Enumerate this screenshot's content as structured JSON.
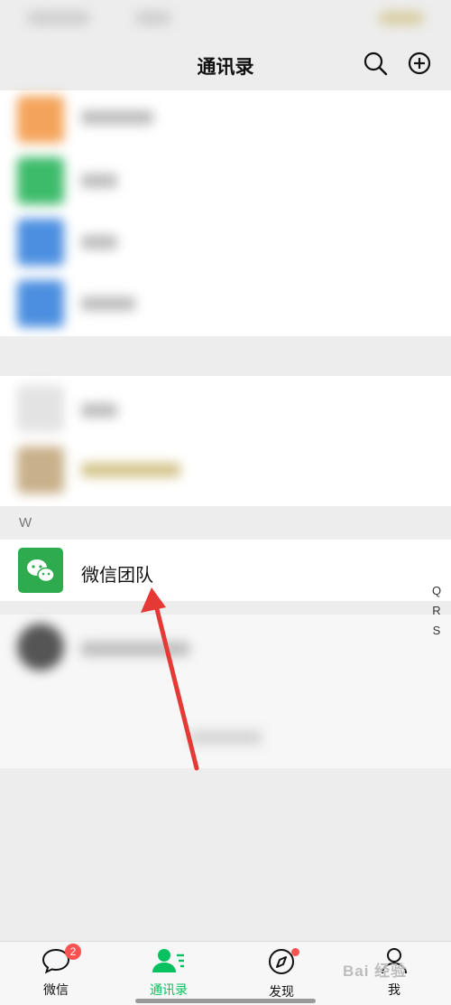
{
  "header": {
    "title": "通讯录"
  },
  "contacts": {
    "section_letter": "W",
    "featured_name": "微信团队"
  },
  "alpha_index": [
    "Q",
    "R",
    "S"
  ],
  "tabs": [
    {
      "label": "微信",
      "badge": "2"
    },
    {
      "label": "通讯录",
      "active": true
    },
    {
      "label": "发现"
    },
    {
      "label": "我"
    }
  ],
  "watermark": "Bai 经验",
  "colors": {
    "accent": "#07c160",
    "badge": "#fa5151",
    "annotation_arrow": "#e53935"
  }
}
